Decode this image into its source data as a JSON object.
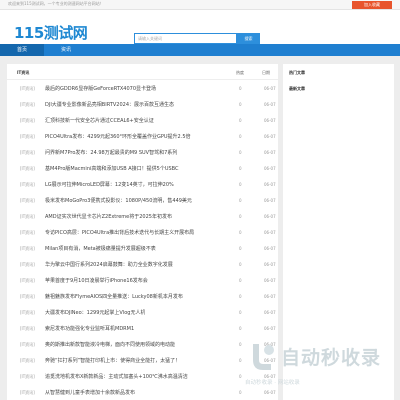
{
  "topbar": {
    "welcome": "欢迎来到115测试网，一个专业的测速网站平台网站！",
    "favorite": "加入收藏"
  },
  "header": {
    "logo": "115测试网",
    "search_placeholder": "请输入关键词",
    "search_button": "搜索"
  },
  "nav": {
    "tabs": [
      "首页",
      "资讯"
    ]
  },
  "main": {
    "title": "IT资讯",
    "col_views": "热度",
    "col_date": "日期",
    "rows": [
      {
        "cat": "[IT资讯]",
        "title": "最后的GDDR6显存版GeForceRTX4070显卡登场",
        "views": "0",
        "date": "06-07"
      },
      {
        "cat": "[IT资讯]",
        "title": "DJI大疆专业影像新品亮相BIRTV2024：展示百款互通生态",
        "views": "0",
        "date": "06-07"
      },
      {
        "cat": "[IT资讯]",
        "title": "汇顶科技新一代安全芯片通过CCEAL6+安全认证",
        "views": "0",
        "date": "06-07"
      },
      {
        "cat": "[IT资讯]",
        "title": "PICO4Ultra发布：4299元起360°环形全覆盖作业GPU提升2.5倍",
        "views": "0",
        "date": "06-07"
      },
      {
        "cat": "[IT资讯]",
        "title": "问界新M7Pro发布：24.98万起最贵的M9 SUV智驾和7系列",
        "views": "0",
        "date": "06-07"
      },
      {
        "cat": "[IT资讯]",
        "title": "基M4Pro版Macmini高端和添加USB A接口！提供5个USBC",
        "views": "0",
        "date": "06-07"
      },
      {
        "cat": "[IT资讯]",
        "title": "LG展示可拉伸MicroLED屏幕：12变14英寸，可拉伸20%",
        "views": "0",
        "date": "06-07"
      },
      {
        "cat": "[IT资讯]",
        "title": "极米发布MoGoPro3便携式投影仪：1080P/450流明，售449美元",
        "views": "0",
        "date": "06-07"
      },
      {
        "cat": "[IT资讯]",
        "title": "AMD证实次世代显卡芯片Z2Extreme将于2025年初发布",
        "views": "0",
        "date": "06-07"
      },
      {
        "cat": "[IT资讯]",
        "title": "专访PICO高层：PICO4Ultra推出背后技术迭代与长期主义开展布局",
        "views": "0",
        "date": "06-07"
      },
      {
        "cat": "[IT资讯]",
        "title": "Milan项目有消，Meta被极痛量提升发展超级不表",
        "views": "0",
        "date": "06-07"
      },
      {
        "cat": "[IT资讯]",
        "title": "华为擎云中国行系列2024启幕鼓舞：助力全业数字化发展",
        "views": "0",
        "date": "06-07"
      },
      {
        "cat": "[IT资讯]",
        "title": "苹果首度于9月10日凌晨举行iPhone16发布会",
        "views": "0",
        "date": "06-07"
      },
      {
        "cat": "[IT资讯]",
        "title": "魅祖魅族发布FlymeAIOS四全量推送：Lucky08新机本月发布",
        "views": "0",
        "date": "06-07"
      },
      {
        "cat": "[IT资讯]",
        "title": "大疆发布DJINeo：1299元起掌上Vlog无人机",
        "views": "0",
        "date": "06-07"
      },
      {
        "cat": "[IT资讯]",
        "title": "索尼发布功能强化专业监听耳机MDRM1",
        "views": "0",
        "date": "06-07"
      },
      {
        "cat": "[IT资讯]",
        "title": "奥的斯推出新款智能液冷电梯，面向不同使用领域的电动能",
        "views": "0",
        "date": "06-07"
      },
      {
        "cat": "[IT资讯]",
        "title": "奔驰“扛打系列”智能打印机上市：使得商业全能打，太猛了！",
        "views": "0",
        "date": "06-07"
      },
      {
        "cat": "[IT资讯]",
        "title": "追觅洗地机发布X新款新品：主动式加塞头+100℃沸水高温清洁",
        "views": "0",
        "date": "06-07"
      },
      {
        "cat": "[IT资讯]",
        "title": "从智慧健到儿童手表增加十余款新品发布",
        "views": "0",
        "date": "06-07"
      }
    ]
  },
  "side": {
    "hot_title": "热门文章",
    "latest_title": "最新文章"
  },
  "watermark": {
    "text": "自动秒收录",
    "sub": "自动秒收录 · 网站收录"
  },
  "colors": {
    "brand": "#1f7fd0",
    "accent": "#e8542c"
  }
}
